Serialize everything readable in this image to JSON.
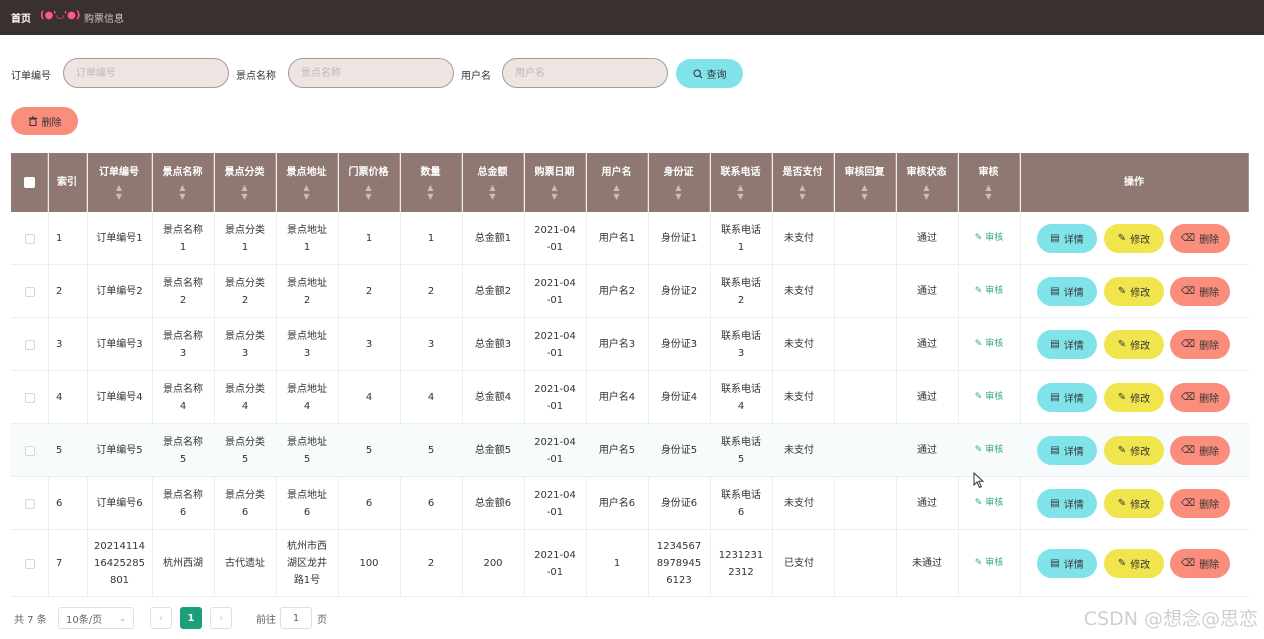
{
  "breadcrumb": {
    "home": "首页",
    "face": "(●'◡'●)",
    "current": "购票信息"
  },
  "filters": [
    {
      "label": "订单编号",
      "placeholder": "订单编号",
      "value": ""
    },
    {
      "label": "景点名称",
      "placeholder": "景点名称",
      "value": ""
    },
    {
      "label": "用户名",
      "placeholder": "用户名",
      "value": ""
    }
  ],
  "buttons": {
    "query": "查询",
    "delete": "删除"
  },
  "table": {
    "columns": [
      "",
      "索引",
      "订单编号",
      "景点名称",
      "景点分类",
      "景点地址",
      "门票价格",
      "数量",
      "总金额",
      "购票日期",
      "用户名",
      "身份证",
      "联系电话",
      "是否支付",
      "审核回复",
      "审核状态",
      "审核",
      "操作"
    ],
    "rows": [
      [
        "1",
        "订单编号1",
        "景点名称\n1",
        "景点分类\n1",
        "景点地址\n1",
        "1",
        "1",
        "总金额1",
        "2021-04\n-01",
        "用户名1",
        "身份证1",
        "联系电话\n1",
        "未支付",
        "",
        "通过",
        "审核"
      ],
      [
        "2",
        "订单编号2",
        "景点名称\n2",
        "景点分类\n2",
        "景点地址\n2",
        "2",
        "2",
        "总金额2",
        "2021-04\n-01",
        "用户名2",
        "身份证2",
        "联系电话\n2",
        "未支付",
        "",
        "通过",
        "审核"
      ],
      [
        "3",
        "订单编号3",
        "景点名称\n3",
        "景点分类\n3",
        "景点地址\n3",
        "3",
        "3",
        "总金额3",
        "2021-04\n-01",
        "用户名3",
        "身份证3",
        "联系电话\n3",
        "未支付",
        "",
        "通过",
        "审核"
      ],
      [
        "4",
        "订单编号4",
        "景点名称\n4",
        "景点分类\n4",
        "景点地址\n4",
        "4",
        "4",
        "总金额4",
        "2021-04\n-01",
        "用户名4",
        "身份证4",
        "联系电话\n4",
        "未支付",
        "",
        "通过",
        "审核"
      ],
      [
        "5",
        "订单编号5",
        "景点名称\n5",
        "景点分类\n5",
        "景点地址\n5",
        "5",
        "5",
        "总金额5",
        "2021-04\n-01",
        "用户名5",
        "身份证5",
        "联系电话\n5",
        "未支付",
        "",
        "通过",
        "审核"
      ],
      [
        "6",
        "订单编号6",
        "景点名称\n6",
        "景点分类\n6",
        "景点地址\n6",
        "6",
        "6",
        "总金额6",
        "2021-04\n-01",
        "用户名6",
        "身份证6",
        "联系电话\n6",
        "未支付",
        "",
        "通过",
        "审核"
      ],
      [
        "7",
        "20214114\n16425285\n801",
        "杭州西湖",
        "古代遗址",
        "杭州市西\n湖区龙井\n路1号",
        "100",
        "2",
        "200",
        "2021-04\n-01",
        "1",
        "1234567\n8978945\n6123",
        "1231231\n2312",
        "已支付",
        "",
        "未通过",
        "审核"
      ]
    ],
    "actions": {
      "detail": "详情",
      "edit": "修改",
      "delete": "删除"
    }
  },
  "pagination": {
    "total": "共 7 条",
    "page_size": "10条/页",
    "current_page": "1",
    "goto_label": "前往",
    "goto_value": "1",
    "page_suffix": "页"
  },
  "watermark": "CSDN @想念@思恋",
  "colors": {
    "header_bg": "#3b3030",
    "table_header": "#8e7871",
    "query_button": "#81e3ea",
    "edit_button": "#f1e54e",
    "delete_button": "#fa8d7c",
    "active_page": "#1a9e7c"
  }
}
